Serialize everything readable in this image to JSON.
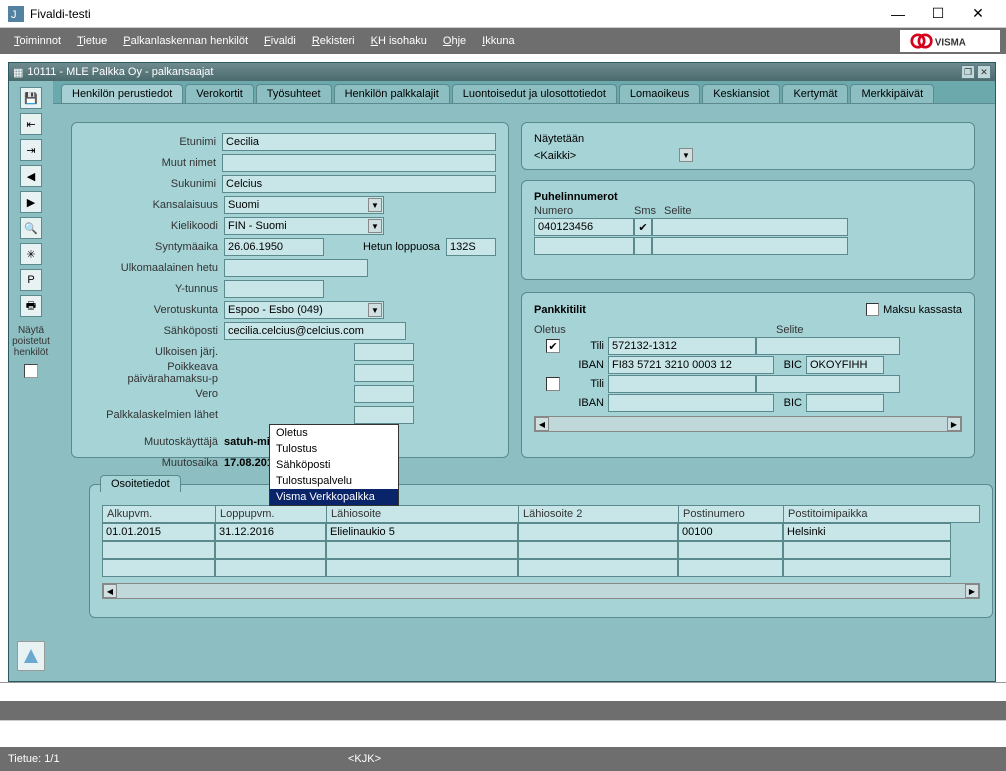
{
  "window": {
    "title": "Fivaldi-testi"
  },
  "menubar": {
    "items": [
      "Toiminnot",
      "Tietue",
      "Palkanlaskennan henkilöt",
      "Fivaldi",
      "Rekisteri",
      "KH isohaku",
      "Ohje",
      "Ikkuna"
    ],
    "logo": "VISMA"
  },
  "inner": {
    "title": "10111 - MLE Palkka Oy - palkansaajat"
  },
  "left_toolbar": {
    "show_deleted_label": "Näytä poistetut henkilöt"
  },
  "tabs": [
    "Henkilön perustiedot",
    "Verokortit",
    "Työsuhteet",
    "Henkilön palkkalajit",
    "Luontoisedut ja ulosottotiedot",
    "Lomaoikeus",
    "Keskiansiot",
    "Kertymät",
    "Merkkipäivät"
  ],
  "form": {
    "labels": {
      "etunimi": "Etunimi",
      "muut": "Muut nimet",
      "sukunimi": "Sukunimi",
      "kansalaisuus": "Kansalaisuus",
      "kielikoodi": "Kielikoodi",
      "syntymaaika": "Syntymäaika",
      "hetun": "Hetun loppuosa",
      "ulkomaalainen": "Ulkomaalainen hetu",
      "ytunnus": "Y-tunnus",
      "verotuskunta": "Verotuskunta",
      "sahkoposti": "Sähköposti",
      "ulkoisen": "Ulkoisen järj.",
      "poikkeava": "Poikkeava päivärahamaksu-p",
      "vero": "Vero",
      "palkkalask": "Palkkalaskelmien lähet",
      "muutoskayttaja": "Muutoskäyttäjä",
      "muutosaika": "Muutosaika"
    },
    "values": {
      "etunimi": "Cecilia",
      "muut": "",
      "sukunimi": "Celcius",
      "kansalaisuus": "Suomi",
      "kielikoodi": "FIN - Suomi",
      "syntymaaika": "26.06.1950",
      "hetun": "132S",
      "ulkomaalainen": "",
      "ytunnus": "",
      "verotuskunta": "Espoo - Esbo (049)",
      "sahkoposti": "cecilia.celcius@celcius.com",
      "muutoskayttaja": "satuh-mik",
      "muutosaika": "17.08.2016 08:49:50"
    },
    "dropdown": {
      "options": [
        "Oletus",
        "Tulostus",
        "Sähköposti",
        "Tulostuspalvelu",
        "Visma Verkkopalkka"
      ],
      "selected": "Visma Verkkopalkka"
    }
  },
  "naytetaan": {
    "label": "Näytetään",
    "value": "<Kaikki>"
  },
  "puhelin": {
    "title": "Puhelinnumerot",
    "headers": [
      "Numero",
      "Sms",
      "Selite"
    ],
    "rows": [
      {
        "numero": "040123456",
        "sms": true,
        "selite": ""
      },
      {
        "numero": "",
        "sms": false,
        "selite": ""
      }
    ]
  },
  "pankki": {
    "title": "Pankkitilit",
    "maksu_label": "Maksu kassasta",
    "maksu_checked": false,
    "headers": {
      "oletus": "Oletus",
      "tili": "Tili",
      "iban": "IBAN",
      "selite": "Selite",
      "bic": "BIC"
    },
    "accounts": [
      {
        "oletus": true,
        "tili": "572132-1312",
        "iban": "FI83 5721 3210 0003 12",
        "bic": "OKOYFIHH"
      },
      {
        "oletus": false,
        "tili": "",
        "iban": "",
        "bic": ""
      }
    ]
  },
  "osoite": {
    "title": "Osoitetiedot",
    "headers": [
      "Alkupvm.",
      "Loppupvm.",
      "Lähiosoite",
      "Lähiosoite 2",
      "Postinumero",
      "Postitoimipaikka"
    ],
    "rows": [
      {
        "alku": "01.01.2015",
        "loppu": "31.12.2016",
        "lahi1": "Elielinaukio 5",
        "lahi2": "",
        "postnr": "00100",
        "postitoimi": "Helsinki"
      },
      {
        "alku": "",
        "loppu": "",
        "lahi1": "",
        "lahi2": "",
        "postnr": "",
        "postitoimi": ""
      }
    ]
  },
  "status": {
    "record": "Tietue: 1/1",
    "center": "<KJK>"
  }
}
